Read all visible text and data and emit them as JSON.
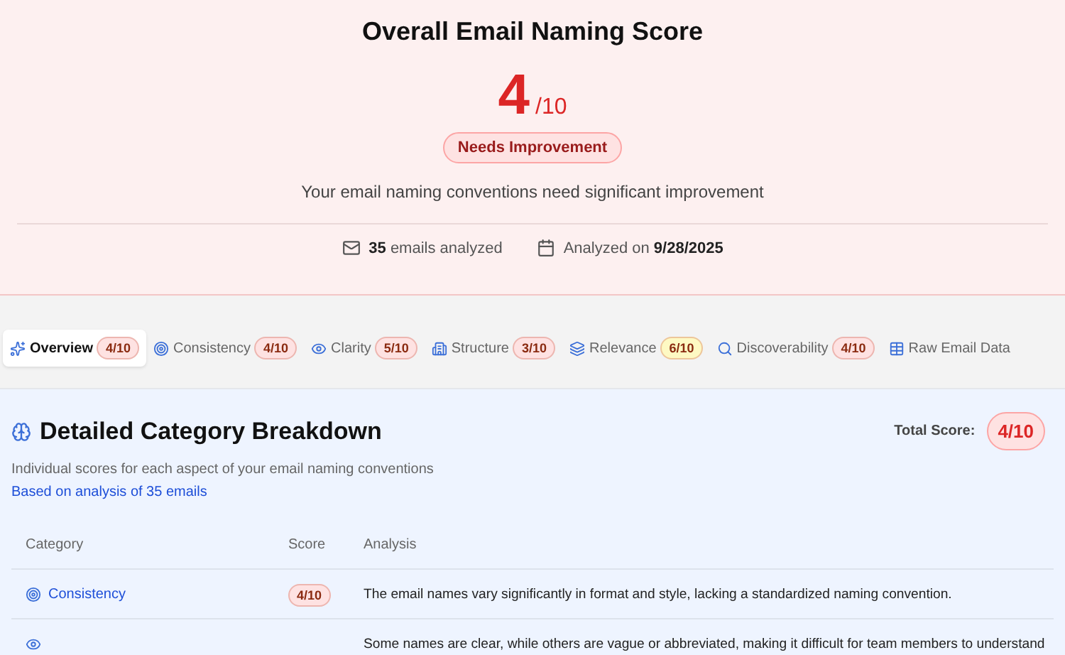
{
  "header": {
    "title": "Overall Email Naming Score",
    "score": "4",
    "score_max": "/10",
    "rating": "Needs Improvement",
    "summary": "Your email naming conventions need significant improvement",
    "emails_count": "35",
    "emails_label": "emails analyzed",
    "date_label": "Analyzed on",
    "date": "9/28/2025"
  },
  "tabs": [
    {
      "label": "Overview",
      "badge": "4/10",
      "color": "#fee2e2",
      "selected": true
    },
    {
      "label": "Consistency",
      "badge": "4/10",
      "color": "#fee2e2",
      "selected": false
    },
    {
      "label": "Clarity",
      "badge": "5/10",
      "color": "#fee2e2",
      "selected": false
    },
    {
      "label": "Structure",
      "badge": "3/10",
      "color": "#fee2e2",
      "selected": false
    },
    {
      "label": "Relevance",
      "badge": "6/10",
      "color": "#fef9c3",
      "selected": false
    },
    {
      "label": "Discoverability",
      "badge": "4/10",
      "color": "#fee2e2",
      "selected": false
    },
    {
      "label": "Raw Email Data",
      "selected": false
    }
  ],
  "breakdown": {
    "title": "Detailed Category Breakdown",
    "subtitle": "Individual scores for each aspect of your email naming conventions",
    "basis": "Based on analysis of 35 emails",
    "total_label": "Total Score:",
    "total": "4/10",
    "columns": [
      "Category",
      "Score",
      "Analysis"
    ],
    "rows": [
      {
        "category": "Consistency",
        "score": "4/10",
        "color": "#fee2e2",
        "analysis": "The email names vary significantly in format and style, lacking a standardized naming convention."
      },
      {
        "analysis": "Some names are clear, while others are vague or abbreviated, making it difficult for team members to understand"
      }
    ]
  }
}
